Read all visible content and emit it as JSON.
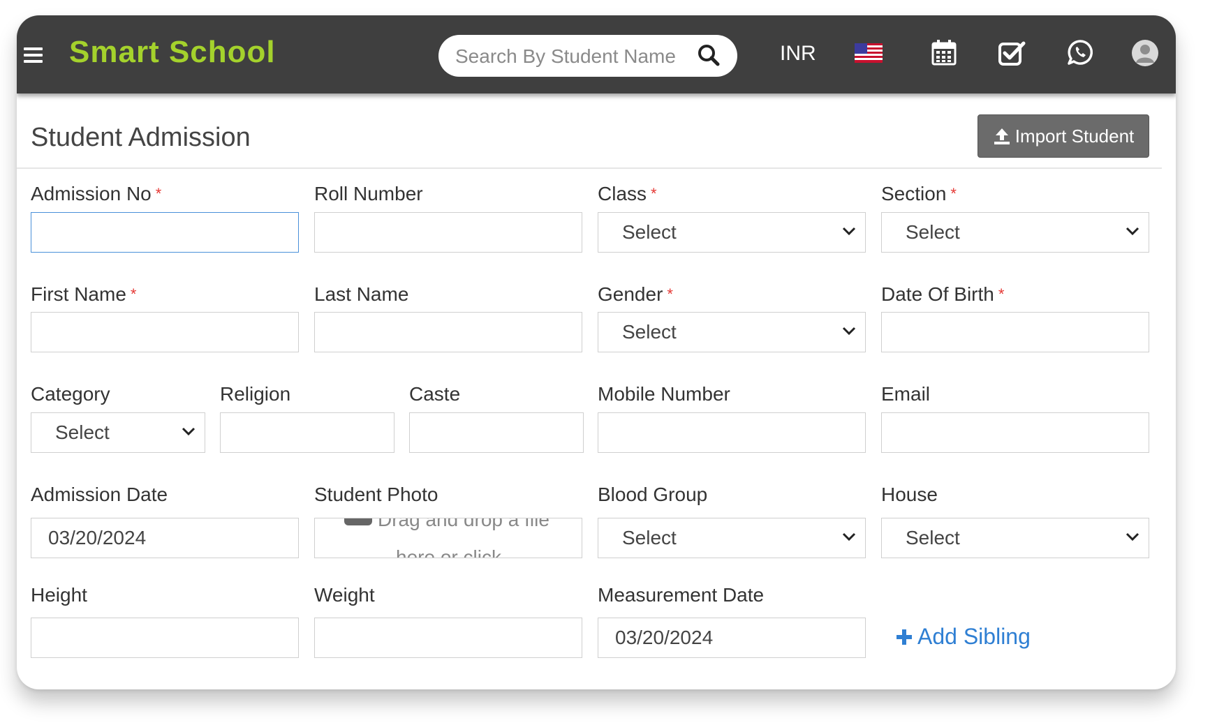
{
  "topbar": {
    "brand": "Smart School",
    "search_placeholder": "Search By Student Name",
    "currency": "INR"
  },
  "page": {
    "title": "Student Admission",
    "import_button": "Import Student"
  },
  "fields": {
    "admission_no": "Admission No",
    "roll_number": "Roll Number",
    "class": "Class",
    "section": "Section",
    "first_name": "First Name",
    "last_name": "Last Name",
    "gender": "Gender",
    "dob": "Date Of Birth",
    "category": "Category",
    "religion": "Religion",
    "caste": "Caste",
    "mobile": "Mobile Number",
    "email": "Email",
    "admission_date": "Admission Date",
    "student_photo": "Student Photo",
    "blood_group": "Blood Group",
    "house": "House",
    "height": "Height",
    "weight": "Weight",
    "measurement_date": "Measurement Date",
    "required_mark": "*"
  },
  "values": {
    "select": "Select",
    "admission_date": "03/20/2024",
    "measurement_date": "03/20/2024"
  },
  "dropzone": {
    "line1": "Drag and drop a file",
    "line2": "here or click"
  },
  "add_sibling": "Add Sibling",
  "colors": {
    "topbar": "#3f3f3f",
    "brand": "#a4d22c",
    "link": "#2f7fd3",
    "required": "#e53935",
    "import_button": "#6b6b6b"
  }
}
